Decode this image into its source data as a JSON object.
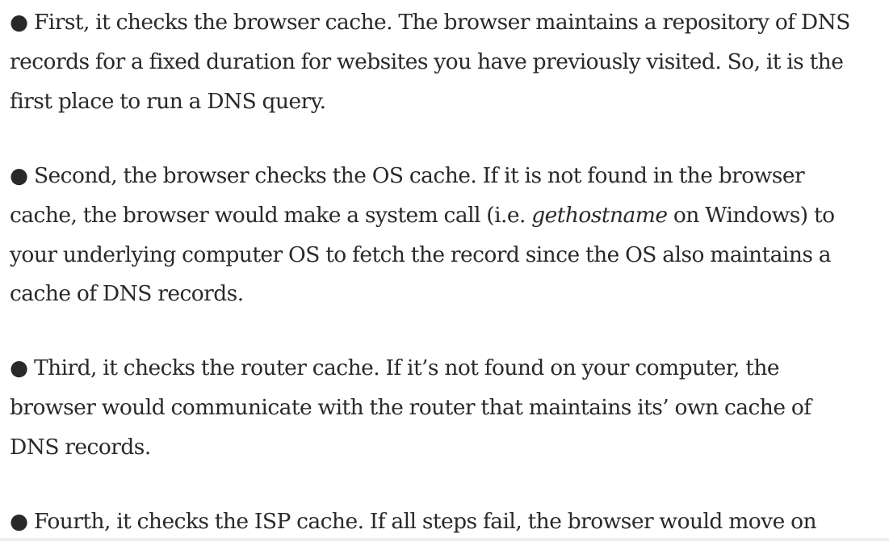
{
  "article": {
    "paragraphs": [
      {
        "text": "● First, it checks the browser cache. The browser maintains a repository of DNS records for a fixed duration for websites you have previously visited. So, it is the first place to run a DNS query."
      },
      {
        "before": "● Second, the browser checks the OS cache. If it is not found in the browser cache, the browser would make a system call (i.e. ",
        "emphasis": "gethostname",
        "after": " on Windows) to your underlying computer OS to fetch the record since the OS also maintains a cache of DNS records."
      },
      {
        "text": "● Third, it checks the router cache. If it’s not found on your computer, the browser would communicate with the router that maintains its’ own cache of DNS records."
      },
      {
        "text": "● Fourth, it checks the ISP cache. If all steps fail, the browser would move on"
      }
    ]
  }
}
